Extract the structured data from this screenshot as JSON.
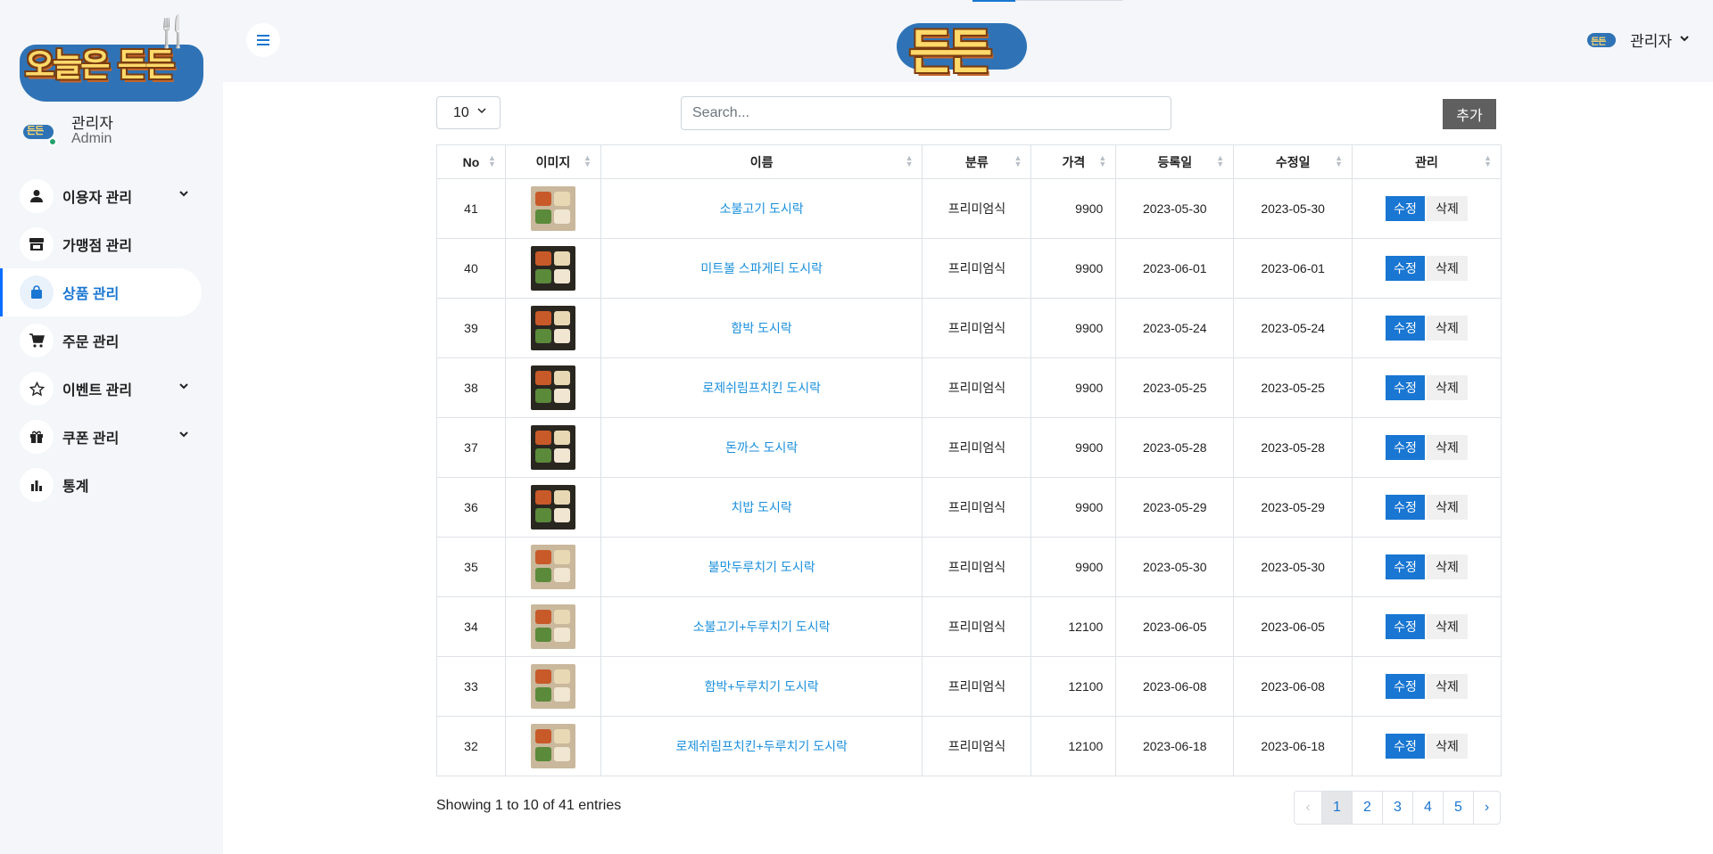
{
  "brand": {
    "sidebar_logo_text": "오늘은 든든",
    "header_logo_text": "든든",
    "avatar_text": "든든"
  },
  "profile": {
    "name": "관리자",
    "role": "Admin"
  },
  "nav": {
    "items": [
      {
        "label": "이용자 관리",
        "icon": "user-icon",
        "has_submenu": true
      },
      {
        "label": "가맹점 관리",
        "icon": "store-icon",
        "has_submenu": false
      },
      {
        "label": "상품 관리",
        "icon": "shopping-bag-icon",
        "has_submenu": false,
        "active": true
      },
      {
        "label": "주문 관리",
        "icon": "cart-icon",
        "has_submenu": false
      },
      {
        "label": "이벤트 관리",
        "icon": "star-icon",
        "has_submenu": true
      },
      {
        "label": "쿠폰 관리",
        "icon": "gift-icon",
        "has_submenu": true
      },
      {
        "label": "통계",
        "icon": "bar-chart-icon",
        "has_submenu": false
      }
    ]
  },
  "header": {
    "user_name": "관리자"
  },
  "toolbar": {
    "page_length": "10",
    "search_placeholder": "Search...",
    "add_label": "추가"
  },
  "table": {
    "columns": [
      "No",
      "이미지",
      "이름",
      "분류",
      "가격",
      "등록일",
      "수정일",
      "관리"
    ],
    "edit_label": "수정",
    "delete_label": "삭제",
    "rows": [
      {
        "no": "41",
        "name": "소불고기 도시락",
        "category": "프리미엄식",
        "price": "9900",
        "created": "2023-05-30",
        "updated": "2023-05-30"
      },
      {
        "no": "40",
        "name": "미트볼 스파게티 도시락",
        "category": "프리미엄식",
        "price": "9900",
        "created": "2023-06-01",
        "updated": "2023-06-01"
      },
      {
        "no": "39",
        "name": "함박 도시락",
        "category": "프리미엄식",
        "price": "9900",
        "created": "2023-05-24",
        "updated": "2023-05-24"
      },
      {
        "no": "38",
        "name": "로제쉬림프치킨 도시락",
        "category": "프리미엄식",
        "price": "9900",
        "created": "2023-05-25",
        "updated": "2023-05-25"
      },
      {
        "no": "37",
        "name": "돈까스 도시락",
        "category": "프리미엄식",
        "price": "9900",
        "created": "2023-05-28",
        "updated": "2023-05-28"
      },
      {
        "no": "36",
        "name": "치밥 도시락",
        "category": "프리미엄식",
        "price": "9900",
        "created": "2023-05-29",
        "updated": "2023-05-29"
      },
      {
        "no": "35",
        "name": "불맛두루치기 도시락",
        "category": "프리미엄식",
        "price": "9900",
        "created": "2023-05-30",
        "updated": "2023-05-30"
      },
      {
        "no": "34",
        "name": "소불고기+두루치기 도시락",
        "category": "프리미엄식",
        "price": "12100",
        "created": "2023-06-05",
        "updated": "2023-06-05"
      },
      {
        "no": "33",
        "name": "함박+두루치기 도시락",
        "category": "프리미엄식",
        "price": "12100",
        "created": "2023-06-08",
        "updated": "2023-06-08"
      },
      {
        "no": "32",
        "name": "로제쉬림프치킨+두루치기 도시락",
        "category": "프리미엄식",
        "price": "12100",
        "created": "2023-06-18",
        "updated": "2023-06-18"
      }
    ]
  },
  "footer": {
    "info": "Showing 1 to 10 of 41 entries",
    "pages": [
      "1",
      "2",
      "3",
      "4",
      "5"
    ],
    "prev": "‹",
    "next": "›",
    "current_page": "1"
  },
  "colors": {
    "primary": "#1976d2",
    "link": "#1a8fdc",
    "logo_blue": "#2f73b6",
    "logo_yellow": "#ffd96a",
    "sidebar_bg": "#f4f6fa"
  }
}
